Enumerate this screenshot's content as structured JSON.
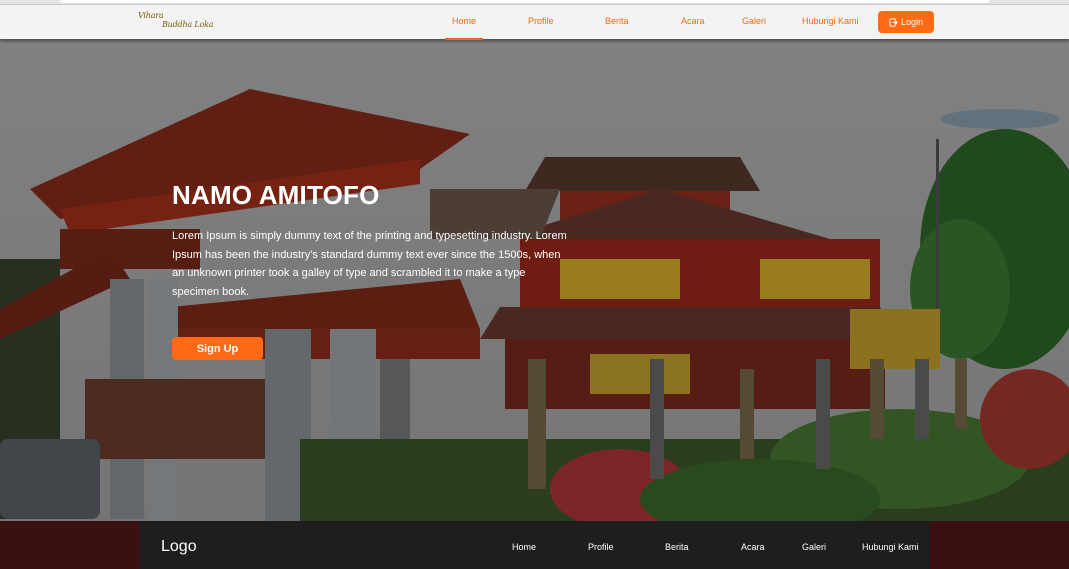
{
  "brand": {
    "line1": "Vihara",
    "line2": "Buddha Loka"
  },
  "nav": {
    "items": [
      {
        "label": "Home",
        "active": true
      },
      {
        "label": "Profile"
      },
      {
        "label": "Berita"
      },
      {
        "label": "Acara"
      },
      {
        "label": "Galeri"
      },
      {
        "label": "Hubungi Kami"
      }
    ],
    "login_label": "Login",
    "login_icon": "login-icon"
  },
  "hero": {
    "title": "NAMO AMITOFO",
    "text": "Lorem Ipsum is simply dummy text of the printing and typesetting industry. Lorem Ipsum has been the industry's standard dummy text ever since the 1500s, when an unknown printer took a galley of type and scrambled it to make a type specimen book.",
    "signup_label": "Sign Up",
    "background": "temple-photo"
  },
  "footer": {
    "logo": "Logo",
    "links": [
      "Home",
      "Profile",
      "Berita",
      "Acara",
      "Galeri",
      "Hubungi Kami"
    ]
  },
  "colors": {
    "accent": "#ff6a14",
    "nav_text": "#ee6a14",
    "footer_bg": "#1e1e1e",
    "footer_side": "#3a1010"
  }
}
